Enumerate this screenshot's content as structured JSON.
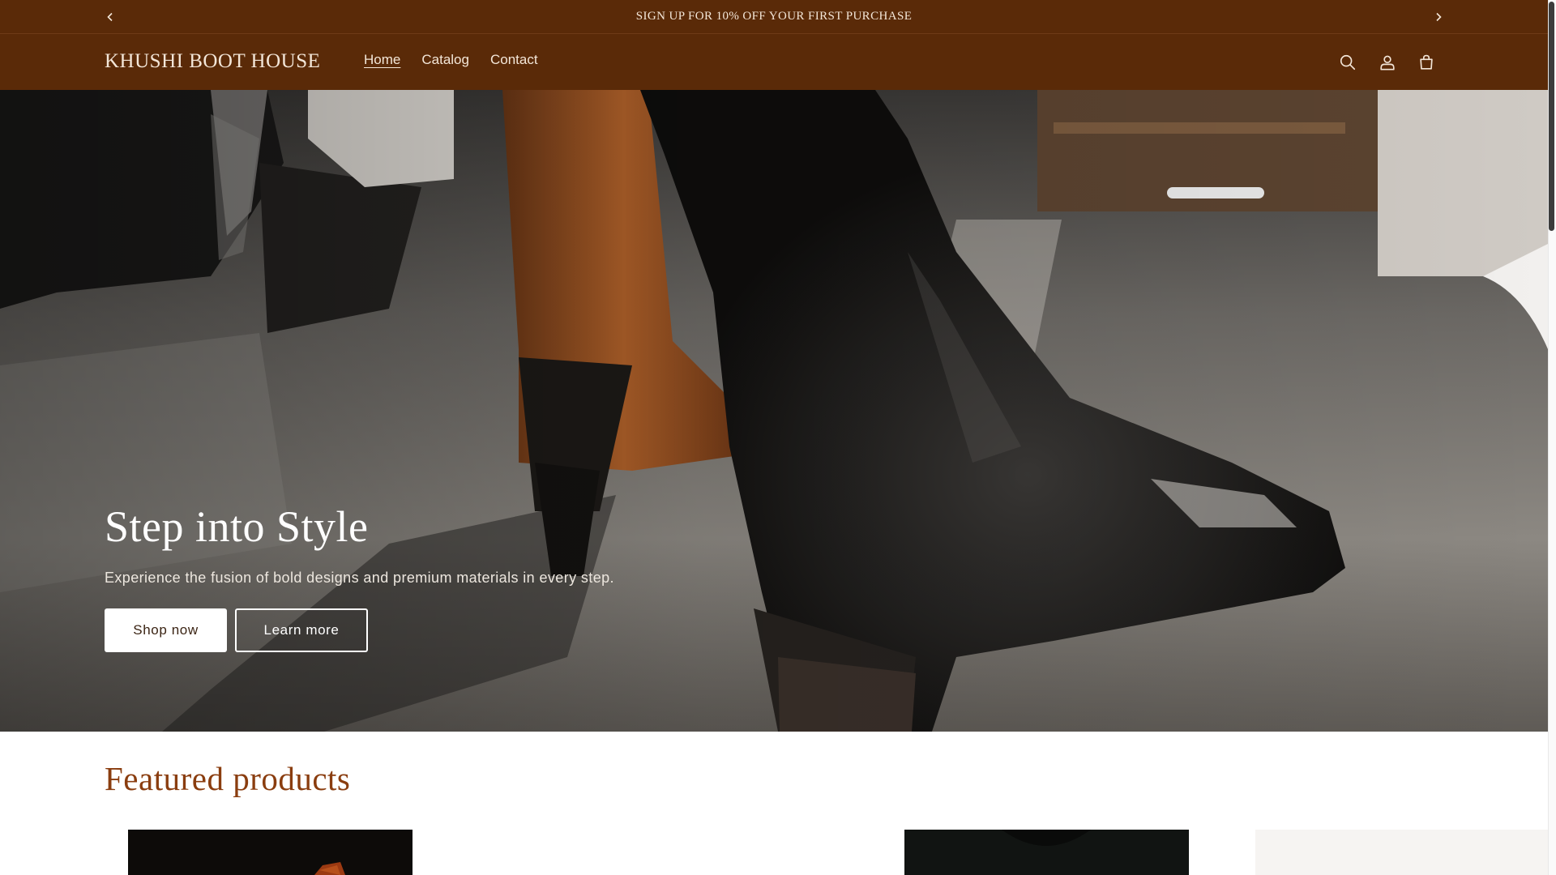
{
  "announcement": {
    "text": "SIGN UP FOR 10% OFF YOUR FIRST PURCHASE",
    "prev_icon": "chevron-left-icon",
    "next_icon": "chevron-right-icon"
  },
  "header": {
    "logo": "KHUSHI BOOT HOUSE",
    "nav": [
      {
        "label": "Home",
        "active": true
      },
      {
        "label": "Catalog",
        "active": false
      },
      {
        "label": "Contact",
        "active": false
      }
    ],
    "icons": [
      "search-icon",
      "account-icon",
      "cart-icon"
    ]
  },
  "hero": {
    "title": "Step into Style",
    "subtitle": "Experience the fusion of bold designs and premium materials in every step.",
    "primary_button": "Shop now",
    "secondary_button": "Learn more"
  },
  "featured": {
    "title": "Featured products"
  },
  "colors": {
    "header_bg": "#5a2a08",
    "header_text": "#f3e6d8",
    "accent_heading": "#8a3d0f",
    "hero_button_bg": "#ffffff"
  }
}
